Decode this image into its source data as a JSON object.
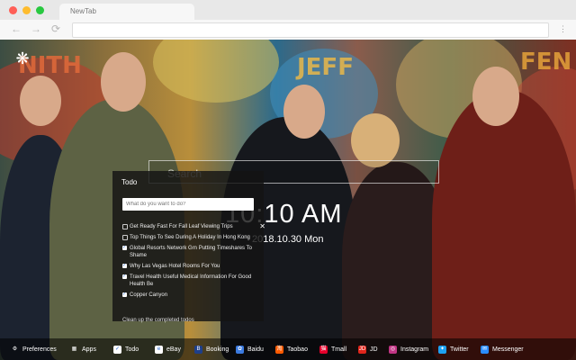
{
  "browser": {
    "tab_title": "NewTab",
    "traffic_lights": [
      "#ff5f57",
      "#febc2e",
      "#28c840"
    ],
    "nav": [
      "←",
      "→",
      "⟳"
    ]
  },
  "search": {
    "placeholder": "Search"
  },
  "clock": {
    "time": "10:10 AM",
    "date": "2018.10.30 Mon"
  },
  "todo": {
    "title": "Todo",
    "input_placeholder": "What do you want to do?",
    "items": [
      {
        "text": "Get Ready Fast For Fall Leaf Viewing Trips",
        "done": false,
        "deletable": true
      },
      {
        "text": "Top Things To See During A Holiday In Hong Kong",
        "done": false,
        "deletable": false
      },
      {
        "text": "Global Resorts Network Grn Putting Timeshares To Shame",
        "done": true,
        "deletable": false
      },
      {
        "text": "Why Las Vegas Hotel Rooms For You",
        "done": true,
        "deletable": false
      },
      {
        "text": "Travel Health Useful Medical Information For Good Health Be",
        "done": true,
        "deletable": false
      },
      {
        "text": "Copper Canyon",
        "done": true,
        "deletable": false
      }
    ],
    "clean_label": "Clean up the completed todos"
  },
  "dock": [
    {
      "label": "Preferences",
      "icon": "gear-icon",
      "color": "transparent"
    },
    {
      "label": "Apps",
      "icon": "apps-grid-icon",
      "color": "transparent"
    },
    {
      "label": "Todo",
      "icon": "checkbox-icon",
      "color": "#ffffff"
    },
    {
      "label": "eBay",
      "icon": "ebay-icon",
      "color": "#ffffff"
    },
    {
      "label": "Booking",
      "icon": "booking-icon",
      "color": "#1e3f8a"
    },
    {
      "label": "Baidu",
      "icon": "baidu-icon",
      "color": "#3b7ae0"
    },
    {
      "label": "Taobao",
      "icon": "taobao-icon",
      "color": "#ff5a00"
    },
    {
      "label": "Tmall",
      "icon": "tmall-icon",
      "color": "#e4002b"
    },
    {
      "label": "JD",
      "icon": "jd-icon",
      "color": "#e1251b"
    },
    {
      "label": "Instagram",
      "icon": "instagram-icon",
      "color": "#c13584"
    },
    {
      "label": "Twitter",
      "icon": "twitter-icon",
      "color": "#1da1f2"
    },
    {
      "label": "Messenger",
      "icon": "messenger-icon",
      "color": "#2a8cff"
    }
  ]
}
